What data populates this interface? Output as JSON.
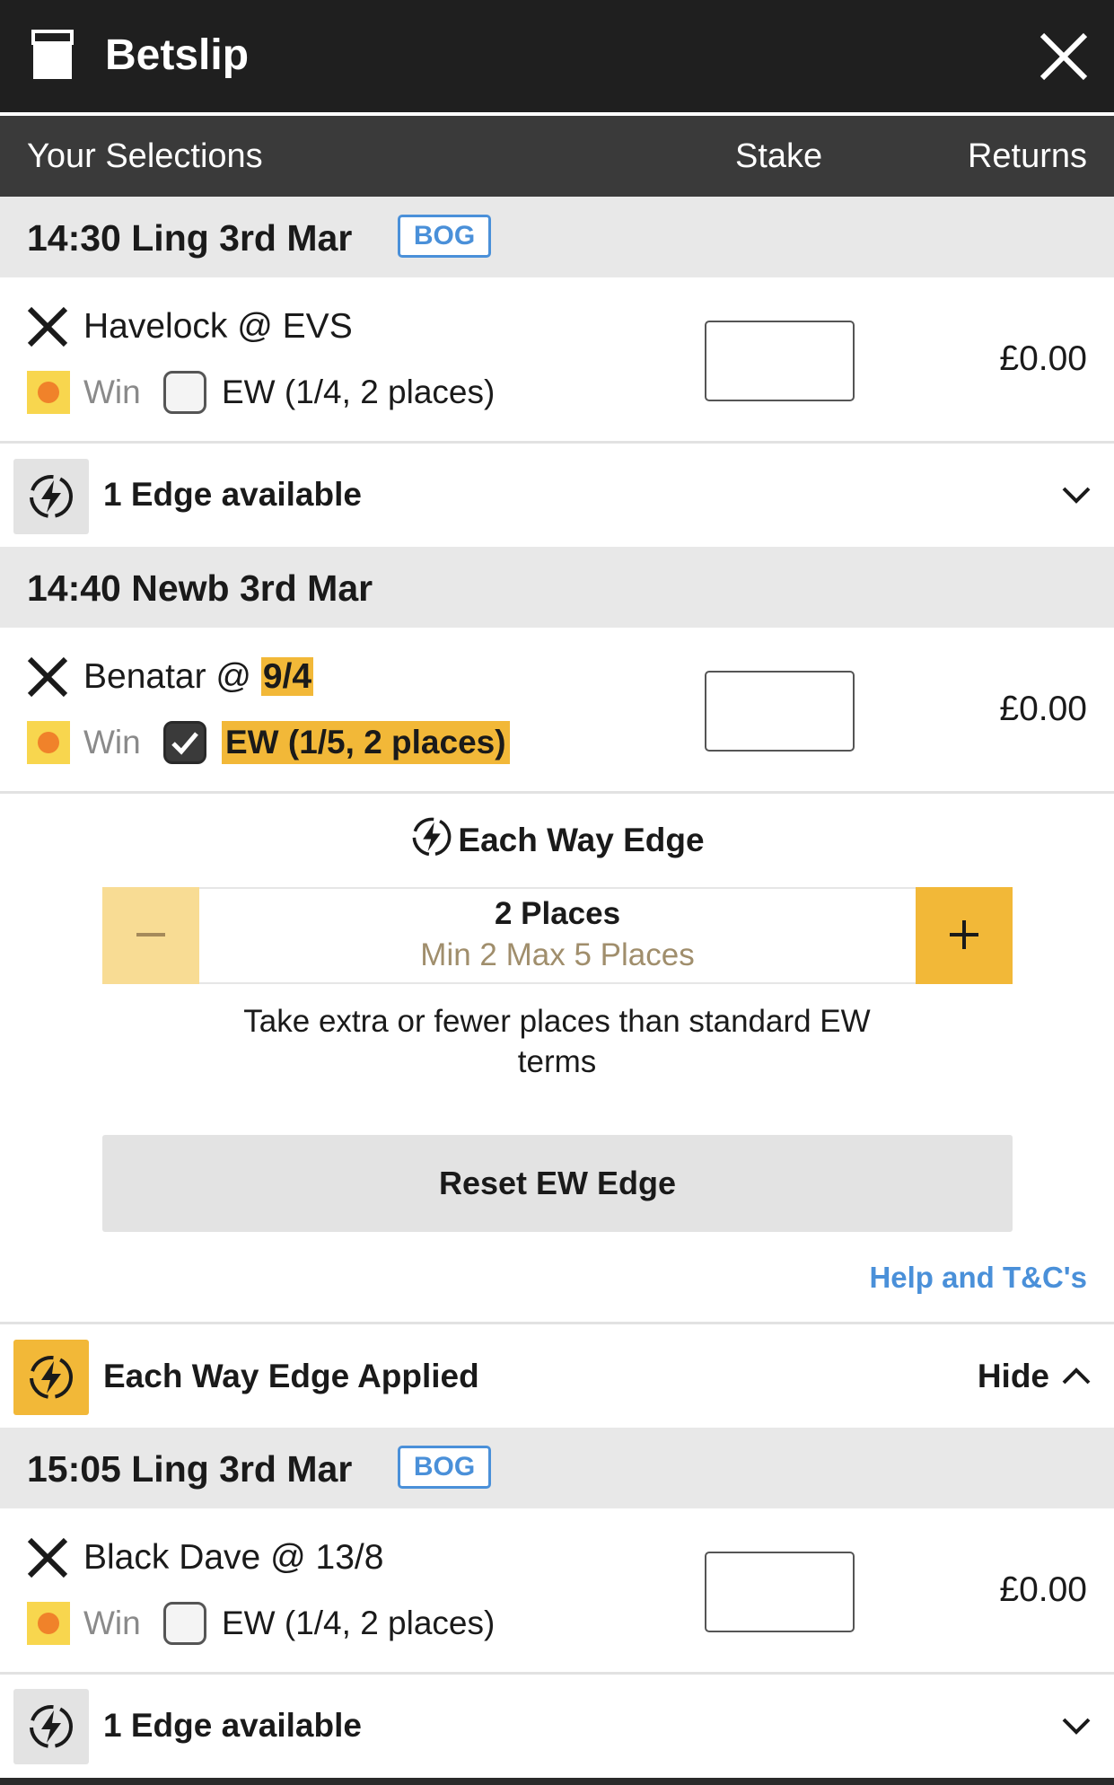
{
  "header": {
    "title": "Betslip",
    "betslip_icon": "betslip-icon",
    "close_icon": "close-icon"
  },
  "columns": {
    "selections": "Your Selections",
    "stake": "Stake",
    "returns": "Returns"
  },
  "races": [
    {
      "title": "14:30 Ling 3rd Mar",
      "bog": "BOG",
      "selection": {
        "name": "Havelock @ ",
        "odds": "EVS",
        "win_label": "Win",
        "ew_label": "EW (1/4, 2 places)",
        "ew_checked": false,
        "stake": "",
        "returns": "£0.00"
      },
      "edge": {
        "text": "1 Edge available",
        "icon": "lightning-icon"
      }
    },
    {
      "title": "14:40 Newb 3rd Mar",
      "bog": "",
      "selection": {
        "name": "Benatar @ ",
        "odds": "9/4",
        "win_label": "Win",
        "ew_label": "EW (1/5, 2 places)",
        "ew_checked": true,
        "stake": "",
        "returns": "£0.00"
      },
      "ew_edge_panel": {
        "title": "Each Way Edge",
        "places_value": "2 Places",
        "places_range": "Min 2 Max 5 Places",
        "description": "Take extra or fewer places than standard EW terms",
        "reset_label": "Reset EW Edge",
        "help_label": "Help and T&C's"
      },
      "edge": {
        "text": "Each Way Edge Applied",
        "hide_label": "Hide",
        "icon": "lightning-icon"
      }
    },
    {
      "title": "15:05 Ling 3rd Mar",
      "bog": "BOG",
      "selection": {
        "name": "Black Dave @ ",
        "odds": "13/8",
        "win_label": "Win",
        "ew_label": "EW (1/4, 2 places)",
        "ew_checked": false,
        "stake": "",
        "returns": "£0.00"
      },
      "edge": {
        "text": "1 Edge available",
        "icon": "lightning-icon"
      }
    }
  ],
  "colors": {
    "header_bg": "#1f1f1f",
    "accent_yellow": "#f2b838",
    "link_blue": "#4a90d9"
  }
}
